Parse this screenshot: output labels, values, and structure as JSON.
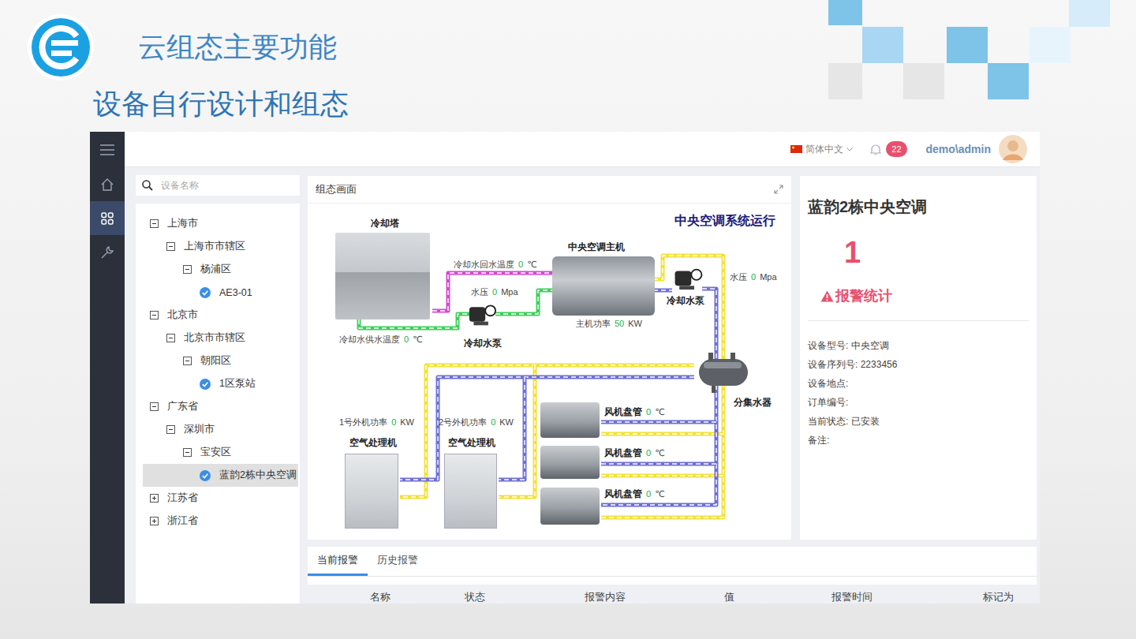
{
  "slide": {
    "title": "云组态主要功能",
    "subtitle": "设备自行设计和组态"
  },
  "header": {
    "language": "简体中文",
    "notification_count": "22",
    "user": "demo\\admin"
  },
  "sidebar": {
    "items": [
      {
        "kind": "menu",
        "selected": false
      },
      {
        "kind": "home",
        "selected": false
      },
      {
        "kind": "grid",
        "selected": true
      },
      {
        "kind": "tool",
        "selected": false
      }
    ]
  },
  "tree": {
    "search_placeholder": "设备名称",
    "items": [
      {
        "label": "上海市",
        "depth": 0,
        "kind": "group",
        "expanded": true,
        "checked": false,
        "selected": false
      },
      {
        "label": "上海市市辖区",
        "depth": 1,
        "kind": "group",
        "expanded": true,
        "checked": false,
        "selected": false
      },
      {
        "label": "杨浦区",
        "depth": 2,
        "kind": "group",
        "expanded": true,
        "checked": false,
        "selected": false
      },
      {
        "label": "AE3-01",
        "depth": 3,
        "kind": "device",
        "expanded": false,
        "checked": true,
        "selected": false
      },
      {
        "label": "北京市",
        "depth": 0,
        "kind": "group",
        "expanded": true,
        "checked": false,
        "selected": false
      },
      {
        "label": "北京市市辖区",
        "depth": 1,
        "kind": "group",
        "expanded": true,
        "checked": false,
        "selected": false
      },
      {
        "label": "朝阳区",
        "depth": 2,
        "kind": "group",
        "expanded": true,
        "checked": false,
        "selected": false
      },
      {
        "label": "1区泵站",
        "depth": 3,
        "kind": "device",
        "expanded": false,
        "checked": true,
        "selected": false
      },
      {
        "label": "广东省",
        "depth": 0,
        "kind": "group",
        "expanded": true,
        "checked": false,
        "selected": false
      },
      {
        "label": "深圳市",
        "depth": 1,
        "kind": "group",
        "expanded": true,
        "checked": false,
        "selected": false
      },
      {
        "label": "宝安区",
        "depth": 2,
        "kind": "group",
        "expanded": true,
        "checked": false,
        "selected": false
      },
      {
        "label": "蓝韵2栋中央空调",
        "depth": 3,
        "kind": "device",
        "expanded": false,
        "checked": true,
        "selected": true
      },
      {
        "label": "江苏省",
        "depth": 0,
        "kind": "group",
        "expanded": false,
        "checked": false,
        "selected": false
      },
      {
        "label": "浙江省",
        "depth": 0,
        "kind": "group",
        "expanded": false,
        "checked": false,
        "selected": false
      }
    ]
  },
  "diagram": {
    "panel_title": "组态画面",
    "heading": "中央空调系统运行",
    "equipment": [
      {
        "label": "冷却塔",
        "kind": "tower"
      },
      {
        "label": "中央空调主机",
        "kind": "chiller"
      },
      {
        "label": "冷却水泵",
        "kind": "pump"
      },
      {
        "label": "冷却水泵",
        "kind": "pump"
      },
      {
        "label": "分集水器",
        "kind": "tank"
      },
      {
        "label": "空气处理机",
        "kind": "ahu"
      },
      {
        "label": "空气处理机",
        "kind": "ahu"
      },
      {
        "label": "",
        "kind": "fancoil"
      },
      {
        "label": "",
        "kind": "fancoil"
      },
      {
        "label": "",
        "kind": "fancoil"
      }
    ],
    "readings": [
      {
        "label": "冷却水回水温度",
        "value": "0",
        "unit": "℃",
        "kind": "sensor"
      },
      {
        "label": "水压",
        "value": "0",
        "unit": "Mpa",
        "kind": "sensor"
      },
      {
        "label": "冷却水供水温度",
        "value": "0",
        "unit": "℃",
        "kind": "sensor"
      },
      {
        "label": "主机功率",
        "value": "50",
        "unit": "KW",
        "kind": "sensor"
      },
      {
        "label": "水压",
        "value": "0",
        "unit": "Mpa",
        "kind": "sensor"
      },
      {
        "label": "1号外机功率",
        "value": "0",
        "unit": "KW",
        "kind": "sensor"
      },
      {
        "label": "2号外机功率",
        "value": "0",
        "unit": "KW",
        "kind": "sensor"
      },
      {
        "label": "风机盘管",
        "value": "0",
        "unit": "℃",
        "kind": "device"
      },
      {
        "label": "风机盘管",
        "value": "0",
        "unit": "℃",
        "kind": "device"
      },
      {
        "label": "风机盘管",
        "value": "0",
        "unit": "℃",
        "kind": "device"
      }
    ]
  },
  "info": {
    "name": "蓝韵2栋中央空调",
    "alarm_count": "1",
    "alarm_label": "报警统计",
    "fields": [
      {
        "label": "设备型号:",
        "value": "中央空调"
      },
      {
        "label": "设备序列号:",
        "value": "2233456"
      },
      {
        "label": "设备地点:",
        "value": ""
      },
      {
        "label": "订单编号:",
        "value": ""
      },
      {
        "label": "当前状态:",
        "value": "已安装"
      },
      {
        "label": "备注:",
        "value": ""
      }
    ]
  },
  "alarms": {
    "tabs": [
      {
        "label": "当前报警",
        "selected": true
      },
      {
        "label": "历史报警",
        "selected": false
      }
    ],
    "columns": [
      "名称",
      "状态",
      "报警内容",
      "值",
      "报警时间",
      "标记为"
    ]
  }
}
